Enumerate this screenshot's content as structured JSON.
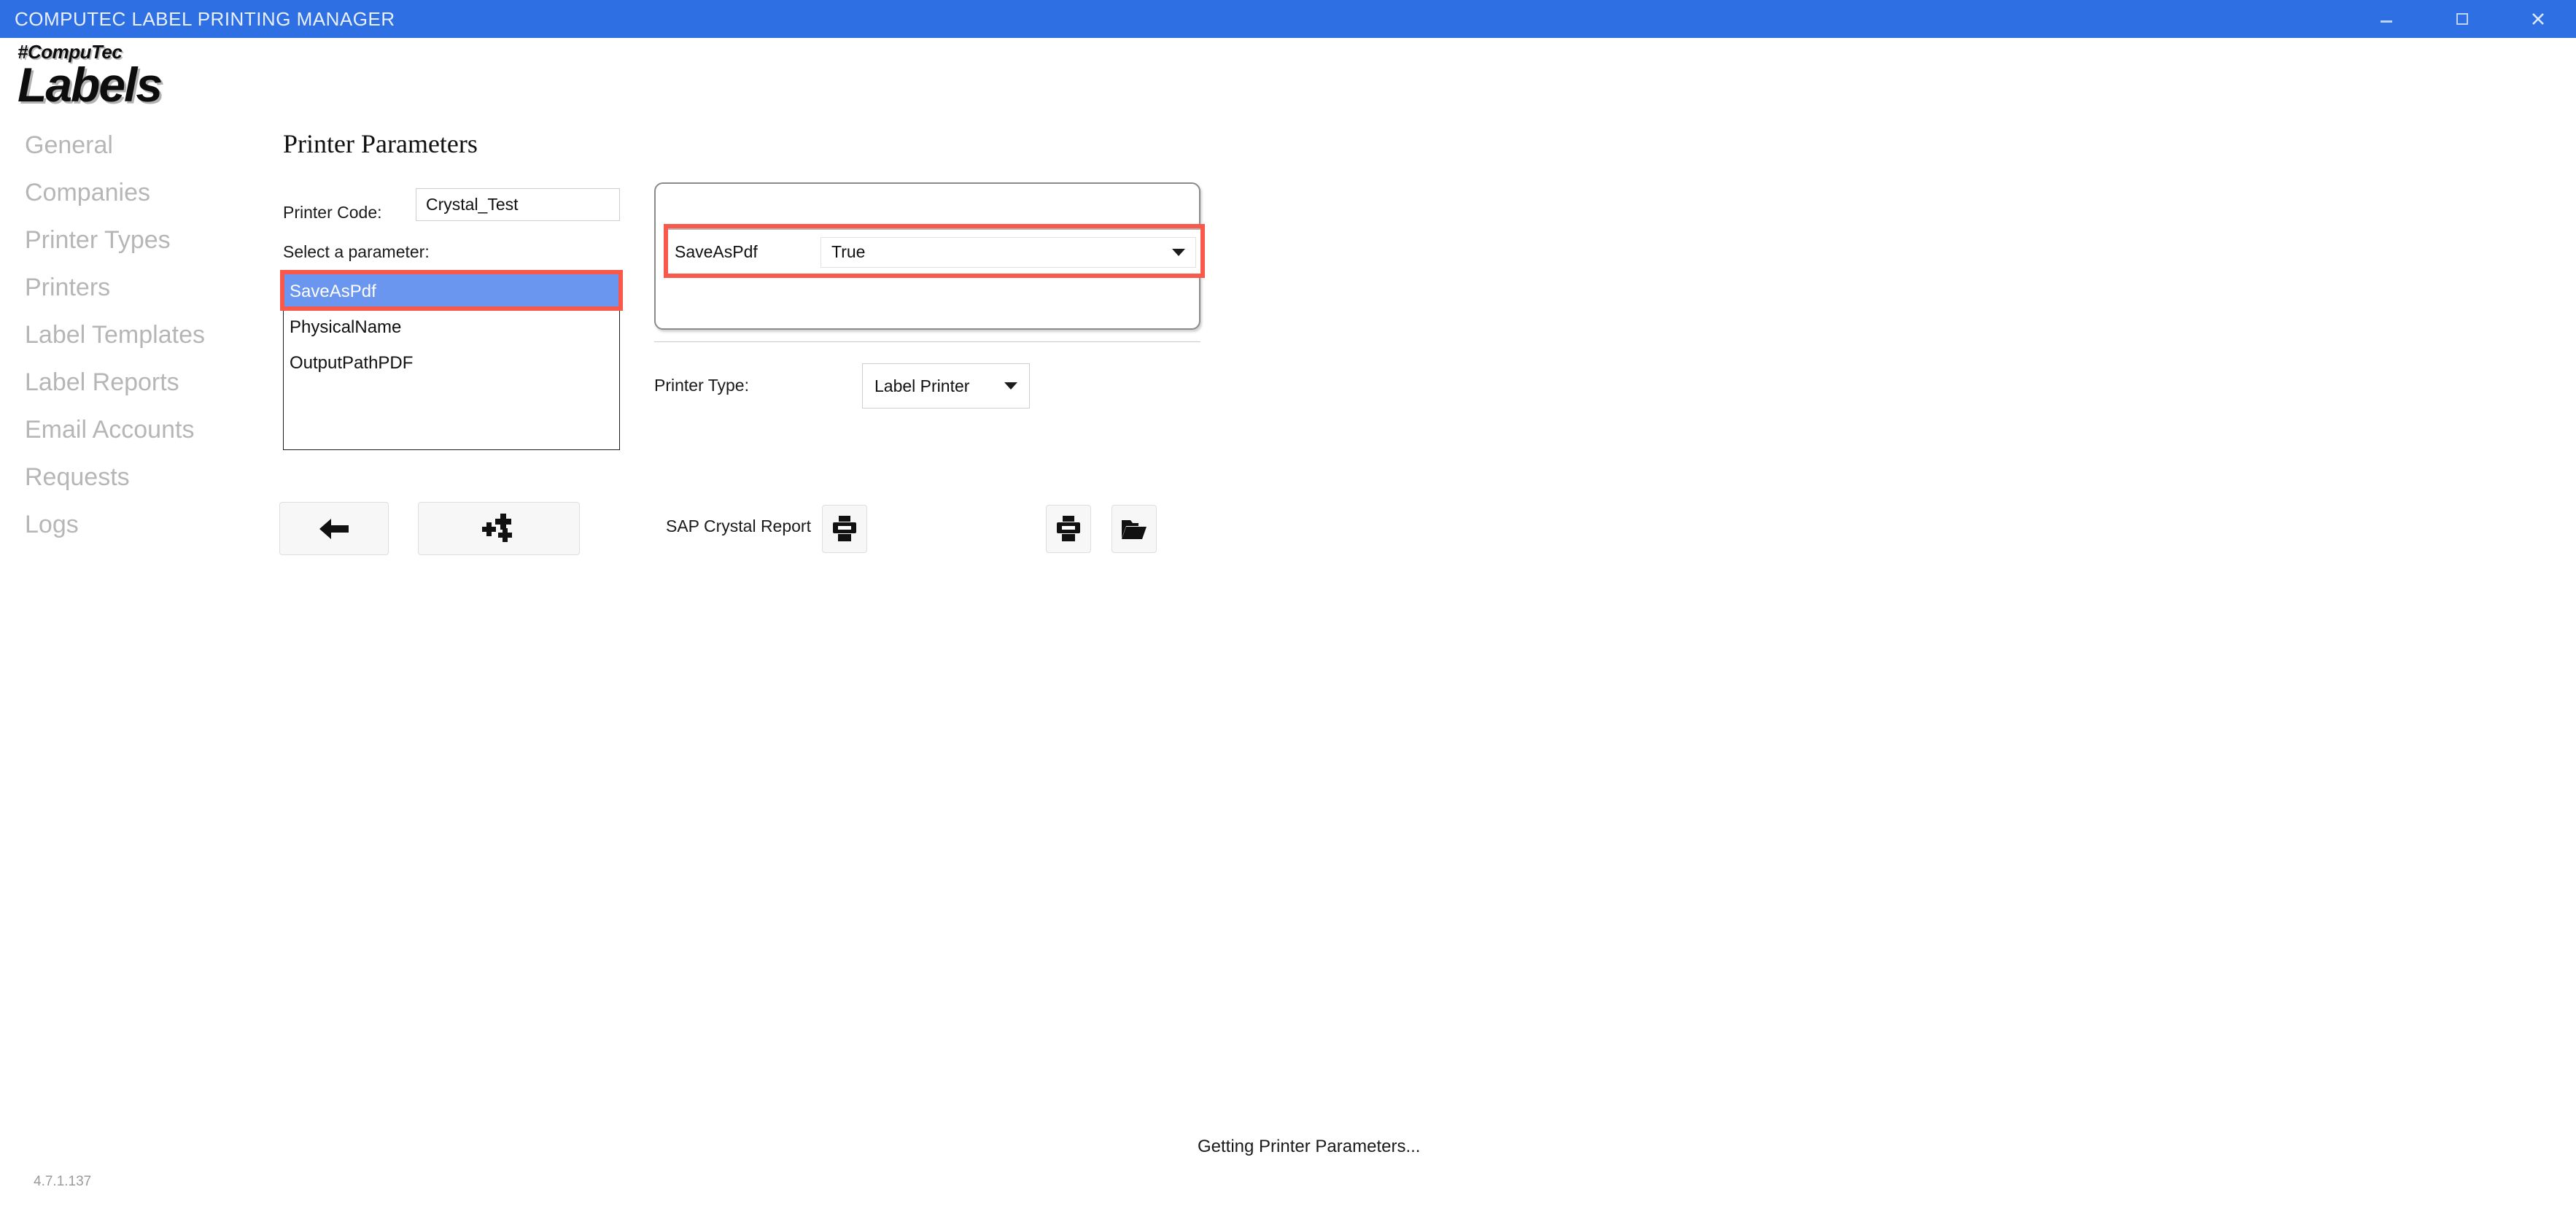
{
  "window": {
    "title": "COMPUTEC LABEL PRINTING MANAGER",
    "accent_color": "#2f6fe4",
    "controls": {
      "minimize": "minimize",
      "maximize": "maximize",
      "close": "close"
    }
  },
  "logo": {
    "top": "#CompuTec",
    "main": "Labels"
  },
  "sidebar": {
    "items": [
      {
        "label": "General"
      },
      {
        "label": "Companies"
      },
      {
        "label": "Printer Types"
      },
      {
        "label": "Printers"
      },
      {
        "label": "Label Templates"
      },
      {
        "label": "Label Reports"
      },
      {
        "label": "Email Accounts"
      },
      {
        "label": "Requests"
      },
      {
        "label": "Logs"
      }
    ]
  },
  "main": {
    "page_title": "Printer Parameters",
    "printer_code": {
      "label": "Printer Code:",
      "value": "Crystal_Test"
    },
    "select_parameter": {
      "label": "Select a parameter:",
      "items": [
        {
          "label": "SaveAsPdf",
          "selected": true
        },
        {
          "label": "PhysicalName",
          "selected": false
        },
        {
          "label": "OutputPathPDF",
          "selected": false
        }
      ]
    },
    "parameter_editor": {
      "name": "SaveAsPdf",
      "value": "True"
    },
    "printer_type": {
      "label": "Printer Type:",
      "value": "Label Printer"
    },
    "crystal": {
      "label": "SAP Crystal Report"
    },
    "buttons": {
      "back": "back-arrow",
      "add": "add-parameters",
      "crystal_print": "print",
      "print": "print",
      "folder": "open-folder"
    }
  },
  "status": {
    "message": "Getting Printer Parameters...",
    "version": "4.7.1.137"
  },
  "colors": {
    "title_bar": "#2f6fe4",
    "selection": "#6a96f0",
    "annotation": "#f8594a",
    "sidebar_text": "#b6b6b6"
  }
}
